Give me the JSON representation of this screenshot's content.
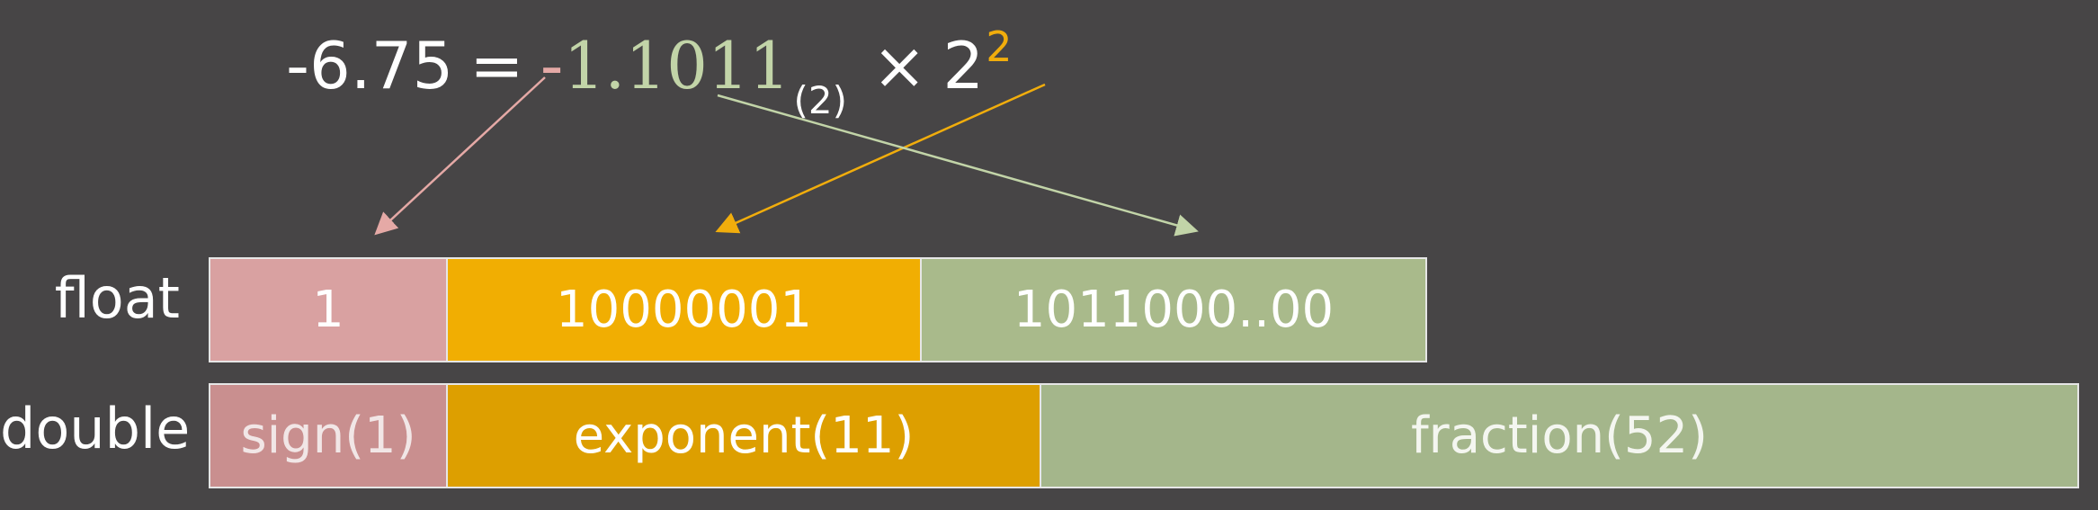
{
  "formula": {
    "lhs": "-6.75",
    "equals": "=",
    "sign": "-",
    "mantissa": "1.1011",
    "base_subscript": "(2)",
    "times": "×",
    "base": "2",
    "exponent": "2"
  },
  "rows": {
    "float": {
      "label": "float",
      "sign": "1",
      "exponent": "10000001",
      "fraction": "1011000..00"
    },
    "double": {
      "label": "double",
      "sign": "sign(1)",
      "exponent": "exponent(11)",
      "fraction": "fraction(52)"
    }
  },
  "colors": {
    "background": "#474546",
    "sign": "#d9a1a1",
    "exponent": "#f1ae02",
    "fraction": "#a9ba8b",
    "sign_arrow": "#e5a9a6",
    "exponent_arrow": "#f1ad0c",
    "fraction_arrow": "#c2d4a8"
  }
}
